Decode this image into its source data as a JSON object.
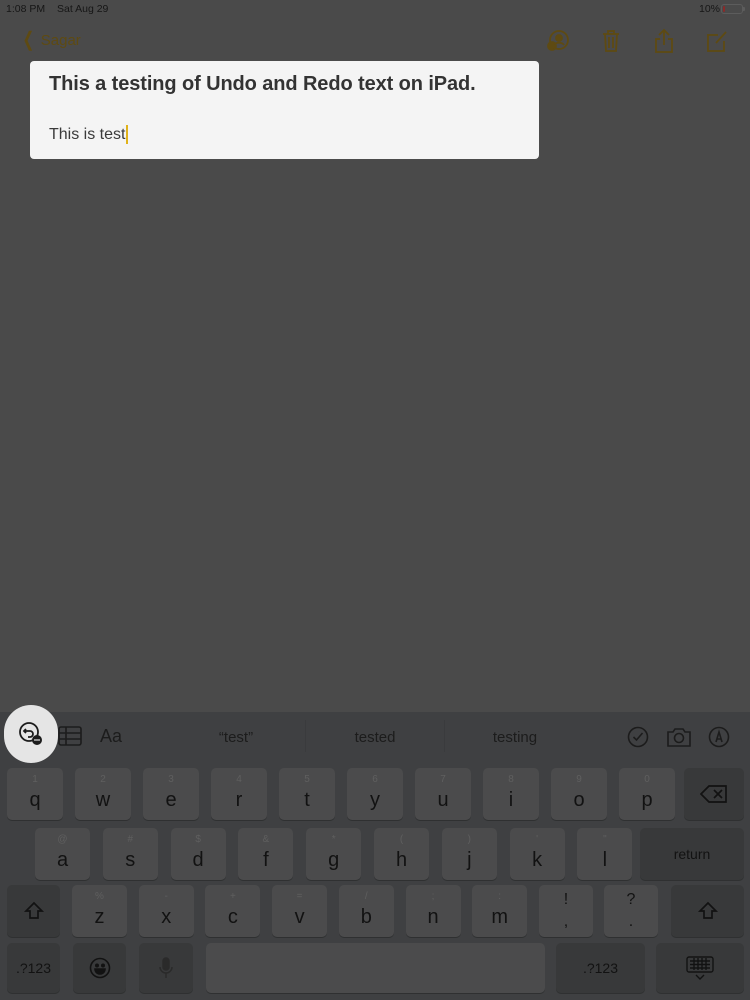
{
  "status_bar": {
    "time": "1:08 PM",
    "date": "Sat Aug 29",
    "battery_percent_label": "10%",
    "battery_level": 0.1,
    "battery_color": "#8a2a2a"
  },
  "nav": {
    "back_label": "Sagar",
    "accent_color": "#5e4a12",
    "icons": [
      "add-person-icon",
      "trash-icon",
      "share-icon",
      "compose-icon"
    ]
  },
  "note": {
    "title": "This a testing of Undo and Redo text on iPad.",
    "body": "This is test",
    "cursor_color": "#e0b21a"
  },
  "shortcut_bar": {
    "left_icons": [
      "undo-icon",
      "table-icon"
    ],
    "format_label": "Aa",
    "suggestions": [
      "“test”",
      "tested",
      "testing"
    ],
    "right_icons": [
      "checklist-icon",
      "camera-icon",
      "markup-icon"
    ]
  },
  "keyboard": {
    "row1": [
      {
        "pri": "q",
        "sec": "1"
      },
      {
        "pri": "w",
        "sec": "2"
      },
      {
        "pri": "e",
        "sec": "3"
      },
      {
        "pri": "r",
        "sec": "4"
      },
      {
        "pri": "t",
        "sec": "5"
      },
      {
        "pri": "y",
        "sec": "6"
      },
      {
        "pri": "u",
        "sec": "7"
      },
      {
        "pri": "i",
        "sec": "8"
      },
      {
        "pri": "o",
        "sec": "9"
      },
      {
        "pri": "p",
        "sec": "0"
      }
    ],
    "row2": [
      {
        "pri": "a",
        "sec": "@"
      },
      {
        "pri": "s",
        "sec": "#"
      },
      {
        "pri": "d",
        "sec": "$"
      },
      {
        "pri": "f",
        "sec": "&"
      },
      {
        "pri": "g",
        "sec": "*"
      },
      {
        "pri": "h",
        "sec": "("
      },
      {
        "pri": "j",
        "sec": ")"
      },
      {
        "pri": "k",
        "sec": "'"
      },
      {
        "pri": "l",
        "sec": "\""
      }
    ],
    "row3": [
      {
        "pri": "z",
        "sec": "%"
      },
      {
        "pri": "x",
        "sec": "-"
      },
      {
        "pri": "c",
        "sec": "+"
      },
      {
        "pri": "v",
        "sec": "="
      },
      {
        "pri": "b",
        "sec": "/"
      },
      {
        "pri": "n",
        "sec": ";"
      },
      {
        "pri": "m",
        "sec": ":"
      }
    ],
    "punct1": {
      "top": "!",
      "bottom": ","
    },
    "punct2": {
      "top": "?",
      "bottom": "."
    },
    "return_label": "return",
    "numbers_label": ".?123",
    "space_label": ""
  }
}
